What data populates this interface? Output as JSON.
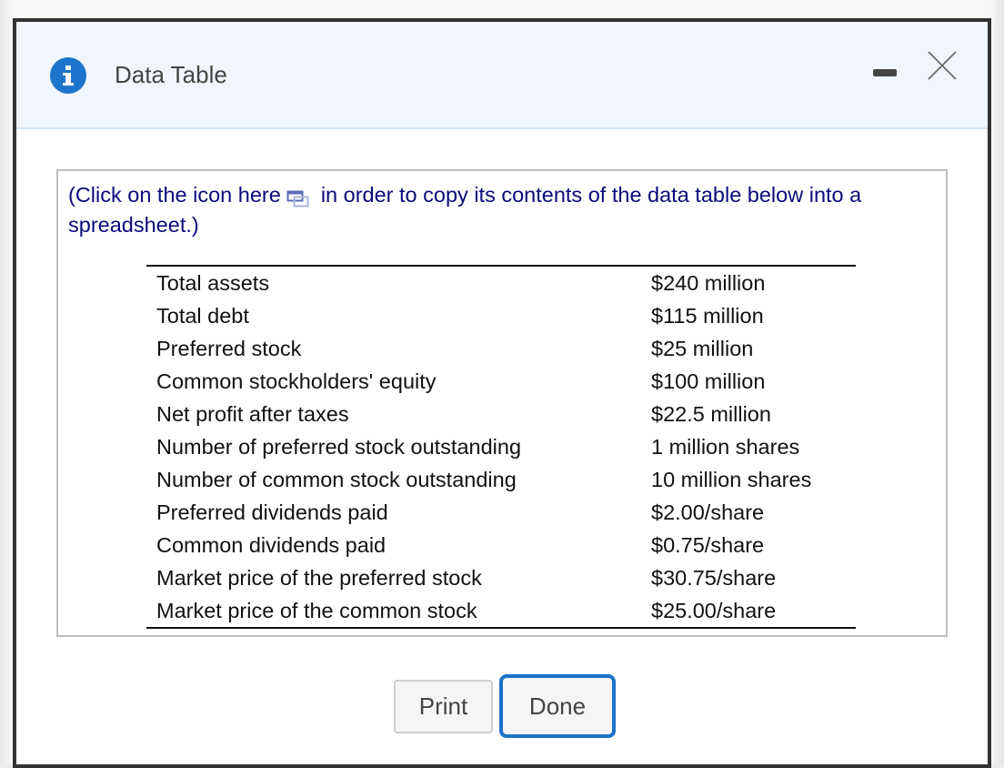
{
  "window": {
    "title": "Data Table",
    "icons": {
      "info": "info-icon",
      "minimize": "minimize-icon",
      "close": "close-icon",
      "copy": "copy-to-spreadsheet-icon"
    }
  },
  "instructions": {
    "before_icon": "(Click on the icon here",
    "after_icon": "in order to copy its contents of the data table below into a spreadsheet.)"
  },
  "table": {
    "rows": [
      {
        "label": "Total assets",
        "value": "$240 million"
      },
      {
        "label": "Total debt",
        "value": "$115 million"
      },
      {
        "label": "Preferred stock",
        "value": "$25 million"
      },
      {
        "label": "Common stockholders' equity",
        "value": "$100 million"
      },
      {
        "label": "Net profit after taxes",
        "value": "$22.5 million"
      },
      {
        "label": "Number of preferred stock outstanding",
        "value": "1 million shares"
      },
      {
        "label": "Number of common stock outstanding",
        "value": "10 million shares"
      },
      {
        "label": "Preferred dividends paid",
        "value": "$2.00/share"
      },
      {
        "label": "Common dividends paid",
        "value": "$0.75/share"
      },
      {
        "label": "Market price of the preferred stock",
        "value": "$30.75/share"
      },
      {
        "label": "Market price of the common stock",
        "value": "$25.00/share"
      }
    ]
  },
  "buttons": {
    "print": "Print",
    "done": "Done"
  },
  "colors": {
    "accent": "#1a73c8",
    "info_icon": "#1c74cc",
    "instruction_text": "#0a0a7a",
    "header_bg": "#f1f5fd"
  }
}
